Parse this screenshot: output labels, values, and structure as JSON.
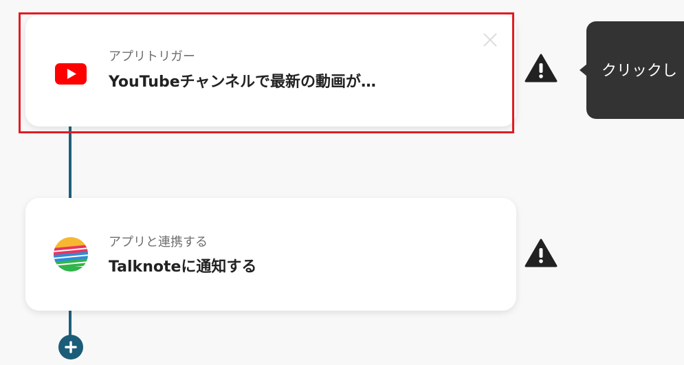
{
  "flow": {
    "steps": [
      {
        "subtitle": "アプリトリガー",
        "title": "YouTubeチャンネルで最新の動画が…",
        "icon": "youtube-icon",
        "selected": true
      },
      {
        "subtitle": "アプリと連携する",
        "title": "Talknoteに通知する",
        "icon": "talknote-icon",
        "selected": false
      }
    ]
  },
  "tooltip": {
    "text": "クリックし"
  },
  "colors": {
    "connector": "#1f5f7a",
    "highlight": "#e01b24",
    "tooltip_bg": "#333333",
    "youtube_red": "#ff0000",
    "add_button": "#1b5d78"
  }
}
